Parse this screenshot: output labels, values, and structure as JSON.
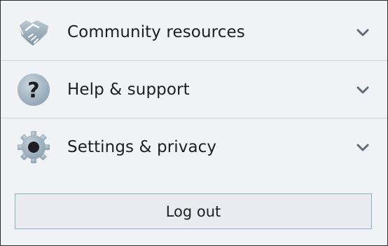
{
  "menu": {
    "items": [
      {
        "label": "Community resources",
        "icon": "handshake-icon"
      },
      {
        "label": "Help & support",
        "icon": "question-icon"
      },
      {
        "label": "Settings & privacy",
        "icon": "gear-icon"
      }
    ],
    "expand_icon": "chevron-down-icon"
  },
  "logout": {
    "label": "Log out"
  },
  "colors": {
    "background": "#f0f2f5",
    "text": "#1c1e21",
    "icon": "#8fa3b3",
    "button_bg": "#e9ebf0",
    "button_border": "#8ab3c4"
  }
}
